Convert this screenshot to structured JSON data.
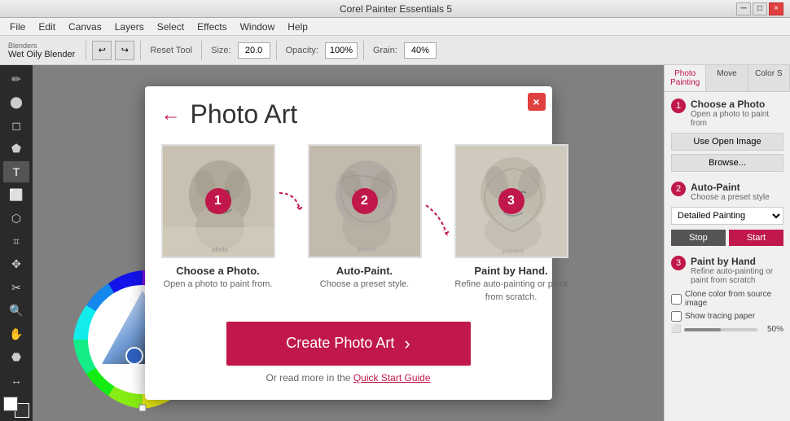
{
  "window": {
    "title": "Corel Painter Essentials 5",
    "close_label": "×",
    "minimize_label": "─",
    "maximize_label": "□"
  },
  "menu": {
    "items": [
      "File",
      "Edit",
      "Canvas",
      "Layers",
      "Select",
      "Effects",
      "Window",
      "Help"
    ]
  },
  "toolbar": {
    "blenders_category": "Blenders",
    "blenders_tool": "Wet Oily Blender",
    "reset_label": "Reset Tool",
    "size_label": "Size:",
    "size_value": "20.0",
    "opacity_label": "Opacity:",
    "opacity_value": "100%",
    "grain_label": "Grain:",
    "grain_value": "40%"
  },
  "left_tools": [
    "✎",
    "⬤",
    "◯",
    "⬛",
    "T",
    "🔲",
    "⬠",
    "⌖",
    "🖊",
    "✂",
    "🔍",
    "✋",
    "⬡",
    "↕"
  ],
  "dialog": {
    "title": "Photo Art",
    "back_label": "←",
    "close_label": "×",
    "steps": [
      {
        "number": "1",
        "title": "Choose a Photo.",
        "description": "Open a photo to paint from."
      },
      {
        "number": "2",
        "title": "Auto-Paint.",
        "description": "Choose a preset style."
      },
      {
        "number": "3",
        "title": "Paint by Hand.",
        "description": "Refine auto-painting or paint from scratch."
      }
    ],
    "create_btn_label": "Create Photo Art",
    "quick_start_text": "Or read more in the ",
    "quick_start_link": "Quick Start Guide",
    "arrow_symbol": "›"
  },
  "right_panel": {
    "tabs": [
      "Photo Painting",
      "Move",
      "Color S"
    ],
    "active_tab": "Photo Painting",
    "section1": {
      "number": "1",
      "title": "Choose a Photo",
      "subtitle": "Open a photo to paint from",
      "btn1": "Use Open Image",
      "btn2": "Browse..."
    },
    "section2": {
      "number": "2",
      "title": "Auto-Paint",
      "subtitle": "Choose a preset style",
      "preset": "Detailed Painting",
      "stop_label": "Stop",
      "start_label": "Start"
    },
    "section3": {
      "number": "3",
      "title": "Paint by Hand",
      "subtitle": "Refine auto-painting or paint from scratch",
      "checkbox1": "Clone color from source image",
      "checkbox2": "Show tracing paper",
      "slider_value": "50%"
    }
  }
}
